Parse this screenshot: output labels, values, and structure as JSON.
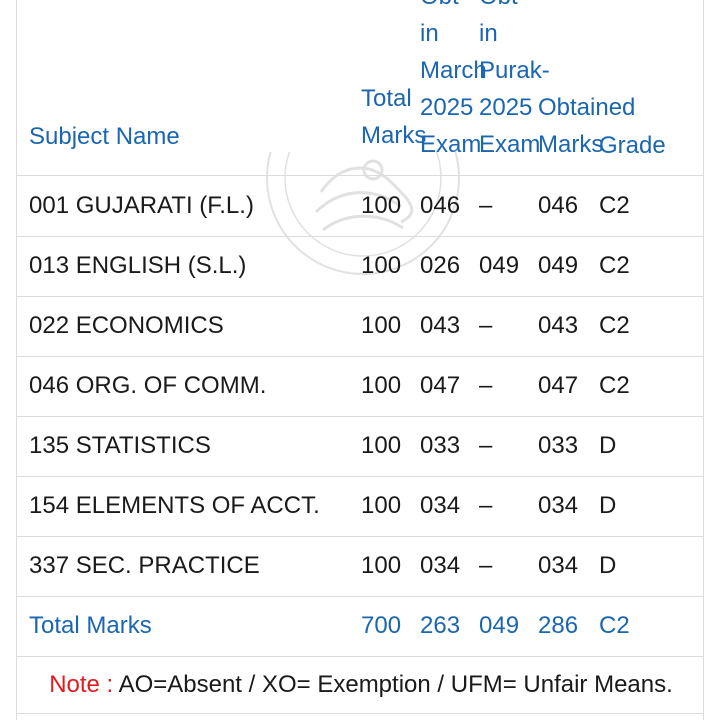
{
  "headers": {
    "subject": [
      "Subject Name"
    ],
    "total": [
      "Total",
      "Marks"
    ],
    "march": [
      "Obt",
      "in",
      "March",
      "2025",
      "Exam"
    ],
    "purak": [
      "Obt",
      "in",
      "Purak-",
      "2025",
      "Exam"
    ],
    "obtained": [
      "Obtained",
      "Marks"
    ],
    "grade": [
      "Grade"
    ]
  },
  "rows": [
    {
      "subject": "001 GUJARATI (F.L.)",
      "total": "100",
      "march": "046",
      "purak": "–",
      "obtained": "046",
      "grade": "C2"
    },
    {
      "subject": "013 ENGLISH (S.L.)",
      "total": "100",
      "march": "026",
      "purak": "049",
      "obtained": "049",
      "grade": "C2"
    },
    {
      "subject": "022 ECONOMICS",
      "total": "100",
      "march": "043",
      "purak": "–",
      "obtained": "043",
      "grade": "C2"
    },
    {
      "subject": "046 ORG. OF COMM.",
      "total": "100",
      "march": "047",
      "purak": "–",
      "obtained": "047",
      "grade": "C2"
    },
    {
      "subject": "135 STATISTICS",
      "total": "100",
      "march": "033",
      "purak": "–",
      "obtained": "033",
      "grade": "D"
    },
    {
      "subject": "154 ELEMENTS OF ACCT.",
      "total": "100",
      "march": "034",
      "purak": "–",
      "obtained": "034",
      "grade": "D"
    },
    {
      "subject": "337 SEC. PRACTICE",
      "total": "100",
      "march": "034",
      "purak": "–",
      "obtained": "034",
      "grade": "D"
    }
  ],
  "total_row": {
    "label": "Total Marks",
    "total": "700",
    "march": "263",
    "purak": "049",
    "obtained": "286",
    "grade": "C2"
  },
  "note": {
    "label": "Note :",
    "text": " AO=Absent / XO= Exemption / UFM= Unfair Means."
  },
  "colors": {
    "header_blue": "#1b66b1",
    "note_red": "#e01d1d",
    "border": "#dcdcdc"
  },
  "watermark": {
    "icon": "board-seal-icon"
  }
}
